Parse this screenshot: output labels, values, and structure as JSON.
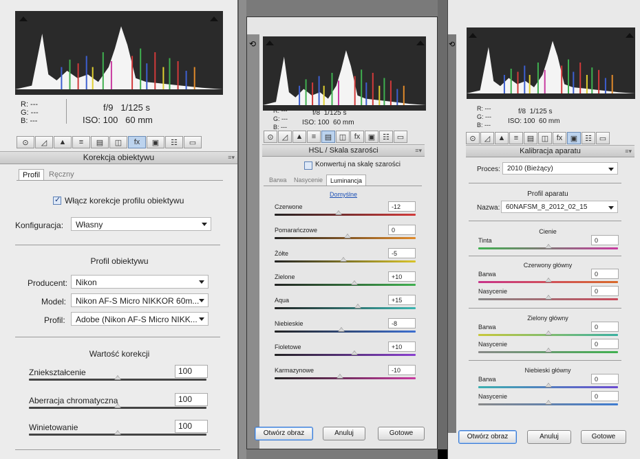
{
  "colors": {
    "red_master": "#d23a3a",
    "green_master": "#3fb04f",
    "blue_master": "#3d7bd0"
  },
  "icons": {
    "hist_clip_left": "triangle-up-icon",
    "hist_clip_right": "triangle-up-icon",
    "panel_menu": "menu-icon"
  },
  "toolbar_tabs": [
    "⊙",
    "◿",
    "▲",
    "≡",
    "▤",
    "◫",
    "fx",
    "▣",
    "☷",
    "▭"
  ],
  "panel1": {
    "readout": {
      "r": "R:  ---",
      "g": "G:  ---",
      "b": "B:  ---",
      "aperture": "f/9",
      "shutter": "1/125 s",
      "iso": "ISO: 100",
      "focal": "60 mm"
    },
    "header": "Korekcja obiektywu",
    "tabs": [
      "Profil",
      "Ręczny"
    ],
    "enable_label": "Włącz korekcje profilu obiektywu",
    "config_label": "Konfiguracja:",
    "config_value": "Własny",
    "profile_heading": "Profil obiektywu",
    "producer_label": "Producent:",
    "producer_value": "Nikon",
    "model_label": "Model:",
    "model_value": "Nikon AF-S Micro NIKKOR 60m...",
    "profil_label": "Profil:",
    "profil_value": "Adobe (Nikon AF-S Micro NIKK...",
    "correction_heading": "Wartość korekcji",
    "sliders": [
      {
        "label": "Zniekształcenie",
        "value": "100",
        "level": 0.5
      },
      {
        "label": "Aberracja chromatyczna",
        "value": "100",
        "level": 0.5
      },
      {
        "label": "Winietowanie",
        "value": "100",
        "level": 0.5
      }
    ]
  },
  "panel2": {
    "readout": {
      "r": "R:  ---",
      "g": "G:  ---",
      "b": "B:  ---",
      "aperture": "f/8",
      "shutter": "1/125 s",
      "iso": "ISO: 100",
      "focal": "60 mm"
    },
    "header": "HSL / Skala szarości",
    "grayscale_label": "Konwertuj na skalę szarości",
    "tabs": [
      "Barwa",
      "Nasycenie",
      "Luminancja"
    ],
    "default_link": "Domyślne",
    "sliders": [
      {
        "label": "Czerwone",
        "value": "-12"
      },
      {
        "label": "Pomarańczowe",
        "value": "0"
      },
      {
        "label": "Żółte",
        "value": "-5"
      },
      {
        "label": "Zielone",
        "value": "+10"
      },
      {
        "label": "Aqua",
        "value": "+15"
      },
      {
        "label": "Niebieskie",
        "value": "-8"
      },
      {
        "label": "Fioletowe",
        "value": "+10"
      },
      {
        "label": "Karmazynowe",
        "value": "-10"
      }
    ],
    "buttons": {
      "open": "Otwórz obraz",
      "cancel": "Anuluj",
      "done": "Gotowe"
    }
  },
  "panel3": {
    "readout": {
      "r": "R:  ---",
      "g": "G:  ---",
      "b": "B:  ---",
      "aperture": "f/8",
      "shutter": "1/125 s",
      "iso": "ISO: 100",
      "focal": "60 mm"
    },
    "header": "Kalibracja aparatu",
    "process_label": "Proces:",
    "process_value": "2010 (Bieżący)",
    "profile_heading": "Profil aparatu",
    "name_label": "Nazwa:",
    "name_value": "60NAFSM_8_2012_02_15",
    "shadows_heading": "Cienie",
    "tint_label": "Tinta",
    "tint_value": "0",
    "red_heading": "Czerwony główny",
    "green_heading": "Zielony główny",
    "blue_heading": "Niebieski główny",
    "hue_label": "Barwa",
    "sat_label": "Nasycenie",
    "zero": "0",
    "buttons": {
      "open": "Otwórz obraz",
      "cancel": "Anuluj",
      "done": "Gotowe"
    }
  }
}
